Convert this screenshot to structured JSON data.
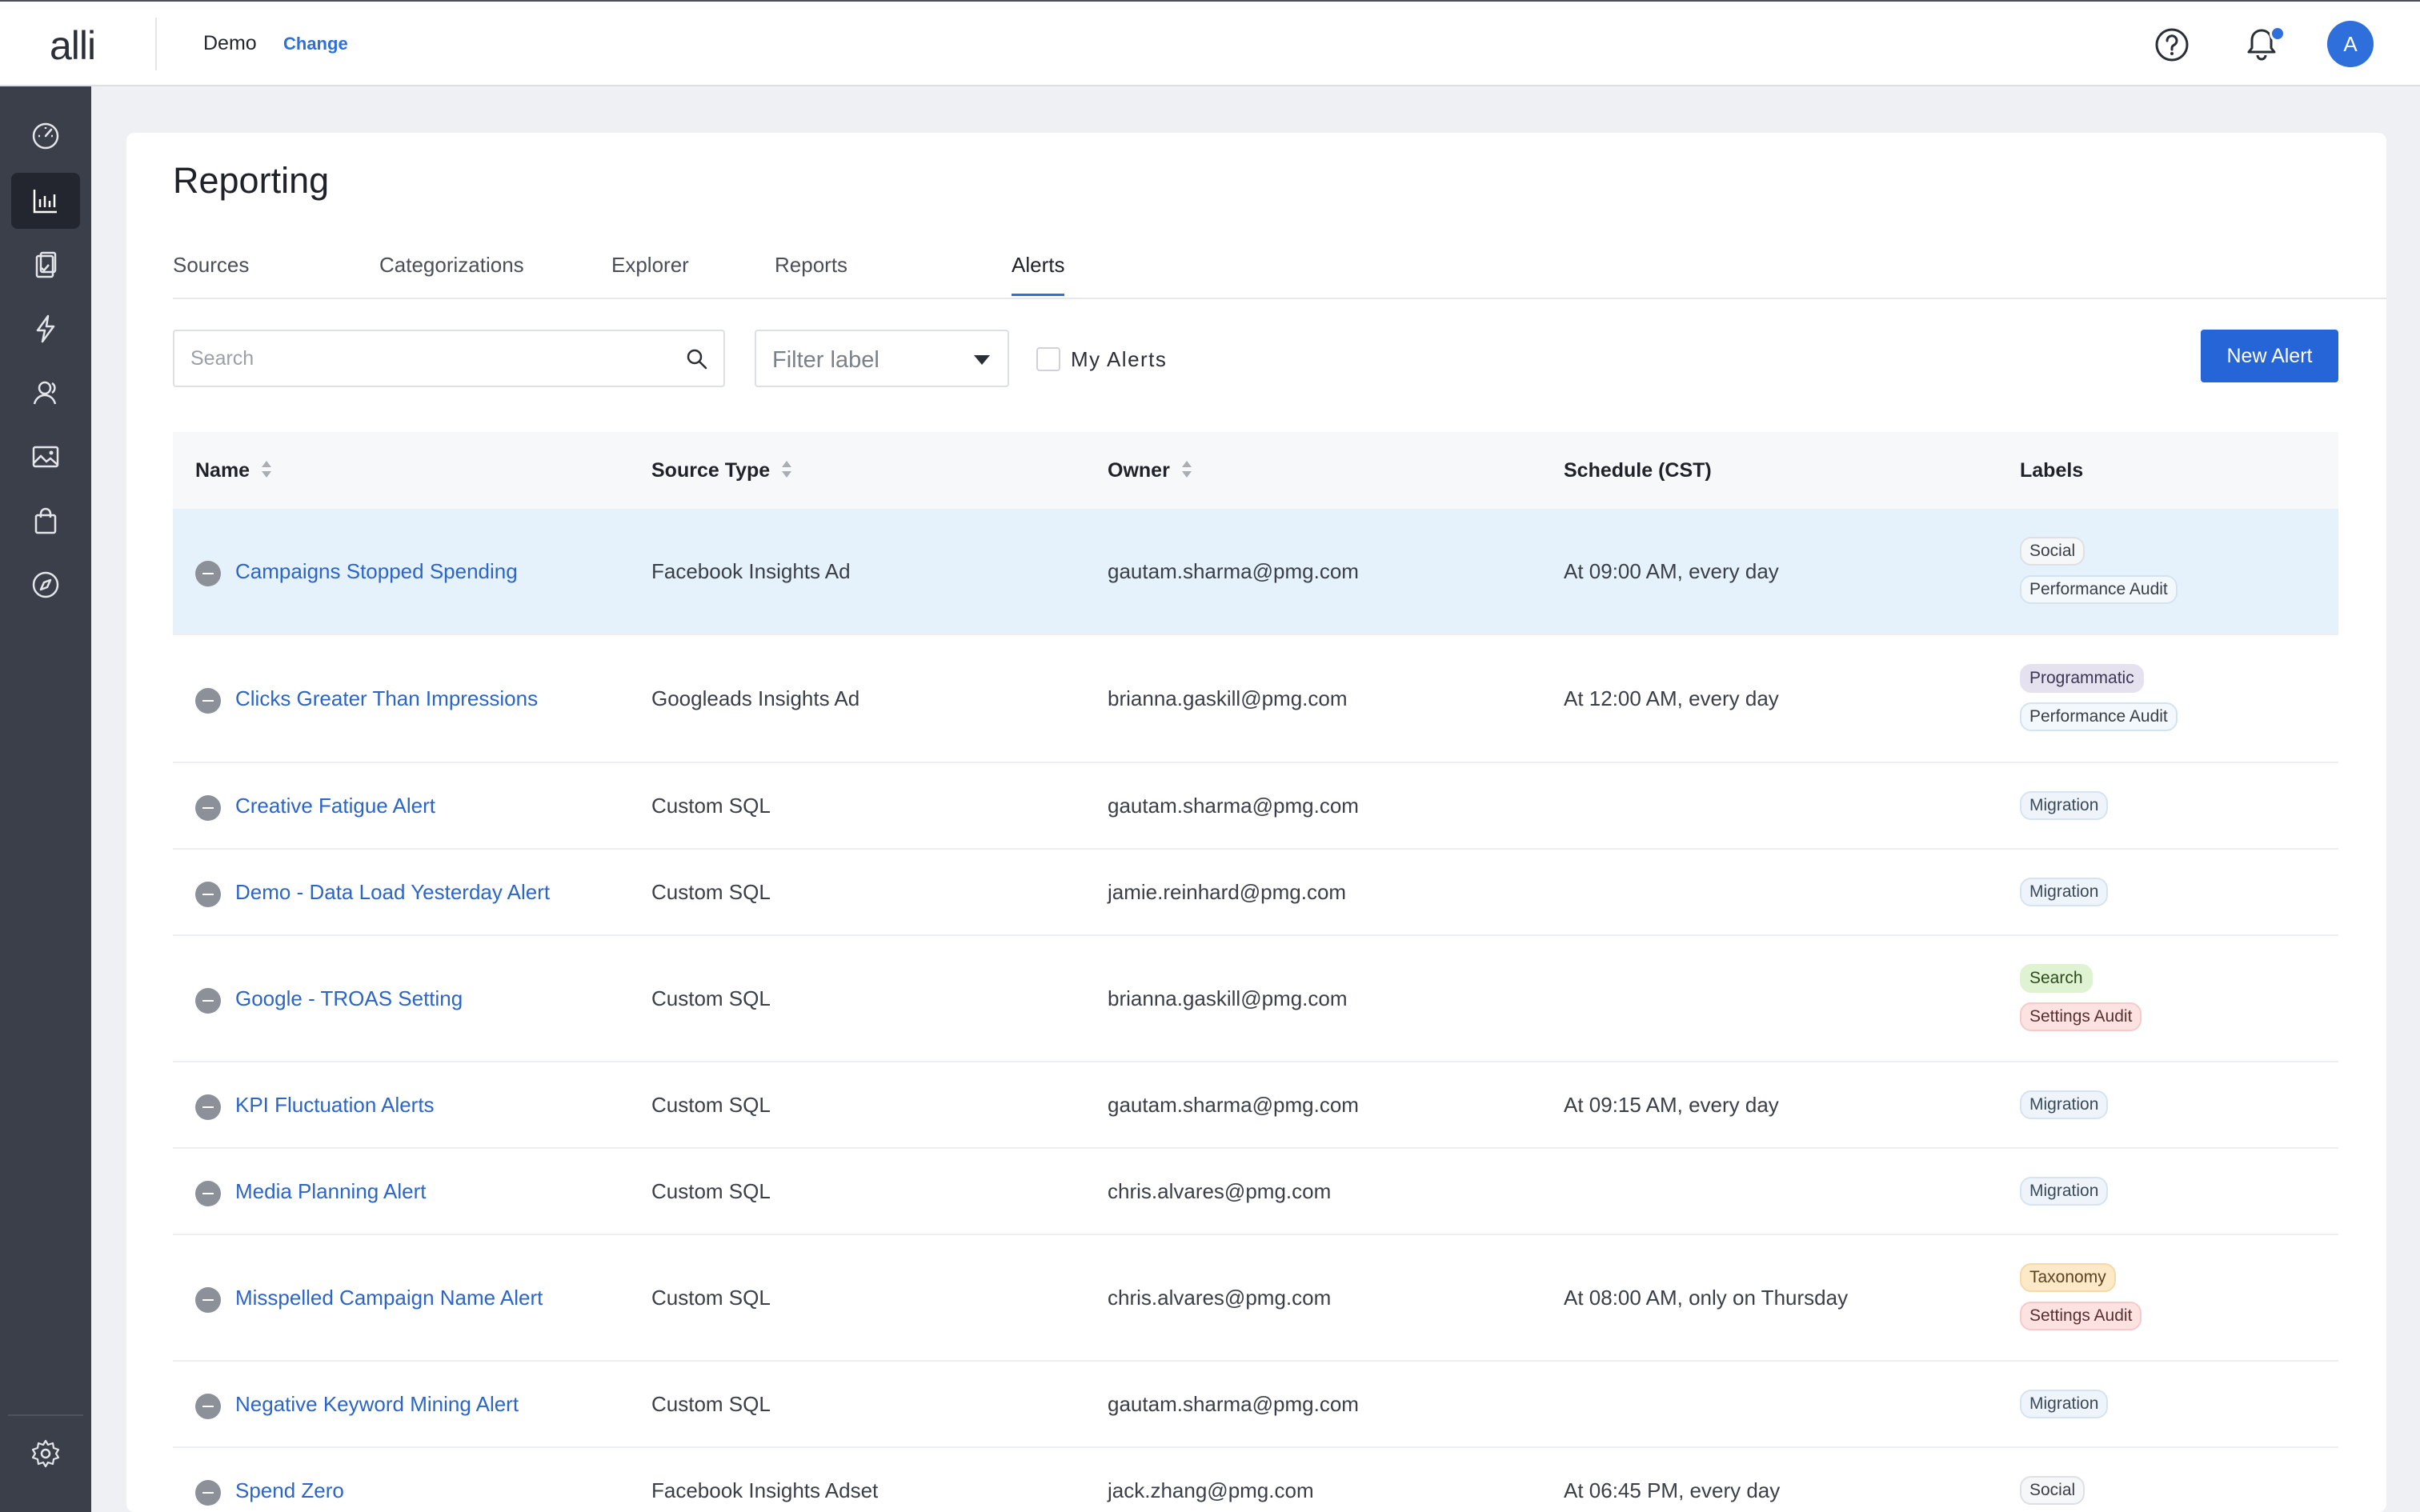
{
  "topbar": {
    "logo": "alli",
    "workspace": "Demo",
    "change_label": "Change",
    "avatar_initial": "A",
    "notification_dot_color": "#2f6fdc"
  },
  "sidebar": {
    "items": [
      {
        "icon": "dashboard-gauge-icon",
        "active": false
      },
      {
        "icon": "bar-chart-icon",
        "active": true
      },
      {
        "icon": "clipboard-check-icon",
        "active": false
      },
      {
        "icon": "lightning-icon",
        "active": false
      },
      {
        "icon": "audience-users-icon",
        "active": false
      },
      {
        "icon": "image-icon",
        "active": false
      },
      {
        "icon": "shopping-bag-icon",
        "active": false
      },
      {
        "icon": "compass-icon",
        "active": false
      }
    ],
    "footer_icon": "gear-icon"
  },
  "page": {
    "title": "Reporting",
    "tabs": [
      "Sources",
      "Categorizations",
      "Explorer",
      "Reports",
      "Alerts"
    ],
    "active_tab": "Alerts"
  },
  "toolbar": {
    "search_placeholder": "Search",
    "filter_value": "Filter label",
    "my_alerts_label": "My Alerts",
    "my_alerts_checked": false,
    "new_alert_label": "New Alert"
  },
  "table": {
    "columns": [
      "Name",
      "Source Type",
      "Owner",
      "Schedule (CST)",
      "Labels"
    ],
    "rows": [
      {
        "name": "Campaigns Stopped Spending",
        "source_type": "Facebook Insights Ad",
        "owner": "gautam.sharma@pmg.com",
        "schedule": "At 09:00 AM, every day",
        "labels": [
          "Social",
          "Performance Audit"
        ],
        "highlighted": true
      },
      {
        "name": "Clicks Greater Than Impressions",
        "source_type": "Googleads Insights Ad",
        "owner": "brianna.gaskill@pmg.com",
        "schedule": "At 12:00 AM, every day",
        "labels": [
          "Programmatic",
          "Performance Audit"
        ]
      },
      {
        "name": "Creative Fatigue Alert",
        "source_type": "Custom SQL",
        "owner": "gautam.sharma@pmg.com",
        "schedule": "",
        "labels": [
          "Migration"
        ]
      },
      {
        "name": "Demo - Data Load Yesterday Alert",
        "source_type": "Custom SQL",
        "owner": "jamie.reinhard@pmg.com",
        "schedule": "",
        "labels": [
          "Migration"
        ]
      },
      {
        "name": "Google - TROAS Setting",
        "source_type": "Custom SQL",
        "owner": "brianna.gaskill@pmg.com",
        "schedule": "",
        "labels": [
          "Search",
          "Settings Audit"
        ]
      },
      {
        "name": "KPI Fluctuation Alerts",
        "source_type": "Custom SQL",
        "owner": "gautam.sharma@pmg.com",
        "schedule": "At 09:15 AM, every day",
        "labels": [
          "Migration"
        ]
      },
      {
        "name": "Media Planning Alert",
        "source_type": "Custom SQL",
        "owner": "chris.alvares@pmg.com",
        "schedule": "",
        "labels": [
          "Migration"
        ]
      },
      {
        "name": "Misspelled Campaign Name Alert",
        "source_type": "Custom SQL",
        "owner": "chris.alvares@pmg.com",
        "schedule": "At 08:00 AM, only on Thursday",
        "labels": [
          "Taxonomy",
          "Settings Audit"
        ]
      },
      {
        "name": "Negative Keyword Mining Alert",
        "source_type": "Custom SQL",
        "owner": "gautam.sharma@pmg.com",
        "schedule": "",
        "labels": [
          "Migration"
        ]
      },
      {
        "name": "Spend Zero",
        "source_type": "Facebook Insights Adset",
        "owner": "jack.zhang@pmg.com",
        "schedule": "At 06:45 PM, every day",
        "labels": [
          "Social"
        ]
      }
    ]
  }
}
